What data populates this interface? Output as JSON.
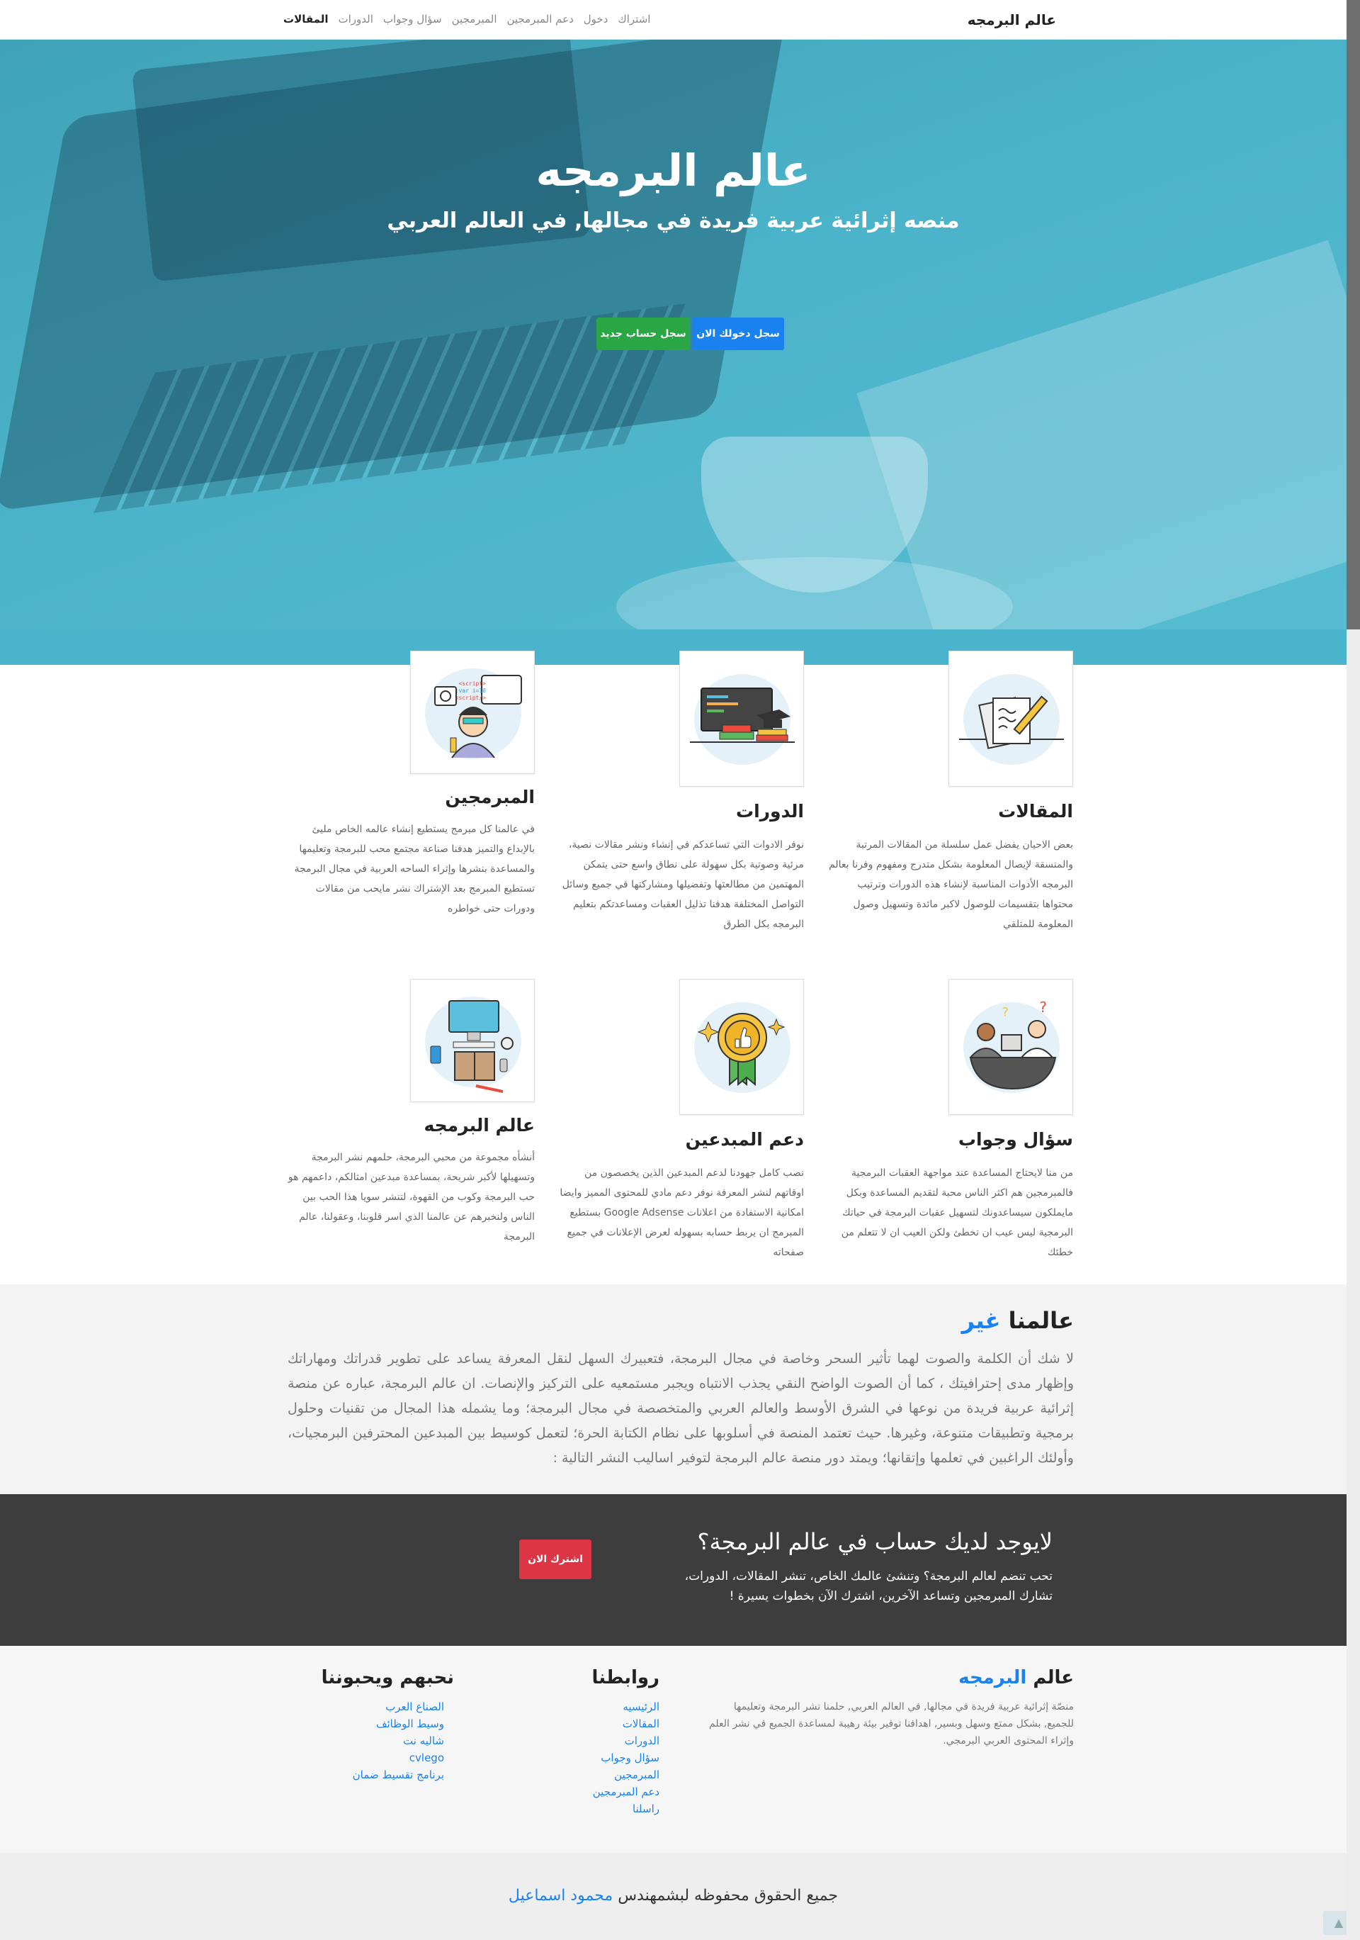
{
  "nav": {
    "brand": "عالم البرمجه",
    "links": [
      "المقالات",
      "الدورات",
      "سؤال وجواب",
      "المبرمجين",
      "دعم المبرمجين",
      "دخول",
      "اشتراك"
    ]
  },
  "hero": {
    "title": "عالم البرمجه",
    "subtitle": "منصه إثرائية عربية فريدة في مجالها, في العالم العربي",
    "login_button": "سجل دخولك الان",
    "register_button": "سجل حساب جديد"
  },
  "features": [
    {
      "title": "المقالات",
      "text": "بعض الاحيان يفضل عمل سلسلة من المقالات المرتبة والمنسقة لإيصال المعلومة بشكل متدرج ومفهوم وفرنا بعالم البرمجه الأدوات المناسبة لإنشاء هذه الدورات وترتيب محتواها بتقسيمات للوصول لاكبر مائدة وتسهيل وصول المعلومة للمتلقي",
      "icon": "articles-icon"
    },
    {
      "title": "الدورات",
      "text": "نوفر الادوات التي تساعدكم في إنشاء ونشر مقالات نصية، مرئية وصوتية بكل سهولة على نطاق واسع حتى يتمكن المهتمين من مطالعتها وتفضيلها ومشاركتها في جميع وسائل التواصل المختلفة هدفنا تذليل العقبات ومساعدتكم بتعليم البرمجه بكل الطرق",
      "icon": "courses-icon"
    },
    {
      "title": "المبرمجين",
      "text": "في عالمنا كل مبرمج يستطيع إنشاء عالمه الخاص مليئ بالإبداع والتميز هدفنا صناعة مجتمع محب للبرمجة وتعليمها والمساعدة بنشرها وإثراء الساحه العربية في مجال البرمجة تستطيع المبرمج بعد الإشتراك نشر مايحب من مقالات ودورات حتى خواطره",
      "icon": "programmers-icon"
    },
    {
      "title": "سؤال وجواب",
      "text": "من منا لايحتاج المساعدة عند مواجهة العقبات البرمجية فالمبرمجين هم اكثر الناس محبة لتقديم المساعدة وبكل مايملكون سيساعدونك لتسهيل عقبات البرمجة في حياتك البرمجية ليس عيب ان تخطئ ولكن العيب ان لا تتعلم من خطئك",
      "icon": "qa-icon"
    },
    {
      "title": "دعم المبدعين",
      "text": "نصب كامل جهودنا لدعم المبدعين الذين يخصصون من اوقاتهم لنشر المعرفة نوفر دعم مادي للمحتوى المميز وايضا امكانية الاستفادة من اعلانات Google Adsense بستطيع المبرمج ان يربط حسابه بسهوله لعرض الإعلانات في جميع صفحاته",
      "icon": "badge-icon"
    },
    {
      "title": "عالم البرمجه",
      "text": "أنشأه مجموعة من محبي البرمجة، حلمهم نشر البرمجة وتسهيلها لأكبر شريحة، بمساعدة مبدعين امثالكم، داعمهم هو حب البرمجة وكوب من القهوة، لتنشر سويا هذا الحب بين الناس ولنخبرهم عن عالمنا الذي اسر قلوبنا، وعقولنا، عالم البرمجة",
      "icon": "workspace-icon"
    }
  ],
  "about": {
    "title_main": "عالمنا",
    "title_accent": "غير",
    "text": "لا شك أن الكلمة والصوت لهما تأثير السحر وخاصة في مجال البرمجة، فتعبيرك السهل لنقل المعرفة يساعد على تطوير قدراتك ومهاراتك وإظهار مدى إحترافيتك ، كما أن الصوت الواضح النقي يجذب الانتباه ويجبر مستمعيه على التركيز والإنصات. ان عالم البرمجة، عباره عن منصة إثرائية عربية فريدة من نوعها في الشرق الأوسط والعالم العربي والمتخصصة في مجال البرمجة؛ وما يشمله هذا المجال من تقنيات وحلول برمجية وتطبيقات متنوعة، وغيرها. حيث تعتمد المنصة في أسلوبها على نظام الكتابة الحرة؛ لتعمل كوسيط بين المبدعين المحترفين البرمجيات، وأولئك الراغبين في تعلمها وإتقانها؛ ويمتد دور منصة عالم البرمجة لتوفير اساليب النشر التالية :"
  },
  "cta": {
    "title": "لايوجد لديك حساب في عالم البرمجة؟",
    "text": "تحب تنضم لعالم البرمجة؟ وتنشئ عالمك الخاص، تنشر المقالات، الدورات، تشارك المبرمجين وتساعد الآخرين، اشترك الآن بخطوات يسيرة !",
    "button": "اشترك الان"
  },
  "footer": {
    "about_title_main": "عالم",
    "about_title_accent": "البرمجه",
    "about_text": "منصّة إثرائية عربية فريدة في مجالها, في العالم العربي, حلمنا نشر البرمجة وتعليمها للجميع, بشكل ممتع وسهل وبسير, اهدافنا توفير بيئة رهيبة لمساعدة الجميع في نشر العلم وإثراء المحتوى العربي البرمجي.",
    "links_title": "روابطنا",
    "links": [
      "الرئيسيه",
      "المقالات",
      "الدورات",
      "سؤال وجواب",
      "المبرمجين",
      "دعم المبرمجين",
      "راسلنا"
    ],
    "friends_title": "نحبهم ويحبوننا",
    "friends": [
      "الصناع العرب",
      "وسيط الوظائف",
      "شاليه نت",
      "cvlego",
      "برنامج تقسيط ضمان"
    ]
  },
  "copyright": {
    "text": "جميع الحقوق محفوظه لبشمهندس",
    "author": "محمود اسماعيل"
  },
  "colors": {
    "accent": "#1a82f0",
    "hero_teal": "#4ab4cd",
    "success": "#2aa745",
    "danger": "#dc3545",
    "cta_bg": "#3d3d3d"
  }
}
